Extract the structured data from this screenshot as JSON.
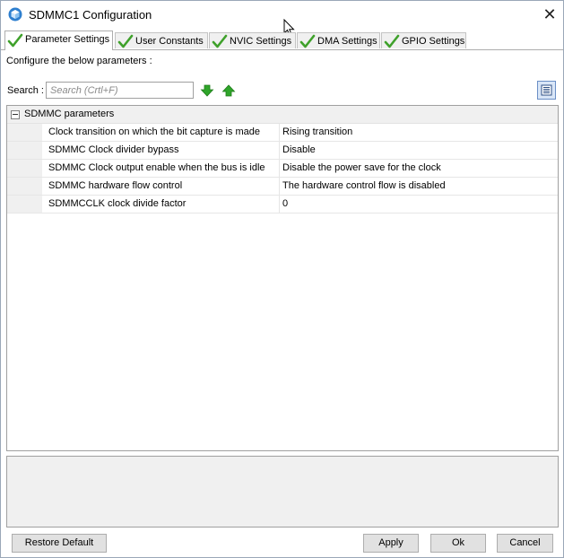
{
  "window": {
    "title": "SDMMC1 Configuration",
    "close_glyph": "✕"
  },
  "tabs": [
    {
      "label": "Parameter Settings",
      "active": true,
      "icon": "check-icon"
    },
    {
      "label": "User Constants",
      "active": false,
      "icon": "check-icon"
    },
    {
      "label": "NVIC Settings",
      "active": false,
      "icon": "check-icon"
    },
    {
      "label": "DMA Settings",
      "active": false,
      "icon": "check-icon"
    },
    {
      "label": "GPIO Settings",
      "active": false,
      "icon": "check-icon"
    }
  ],
  "configure_text": "Configure the below parameters :",
  "search": {
    "label": "Search :",
    "placeholder": "Search (Crtl+F)",
    "value": ""
  },
  "parameters": {
    "group_label": "SDMMC parameters",
    "rows": [
      {
        "name": "Clock transition on which the bit capture is made",
        "value": "Rising transition"
      },
      {
        "name": "SDMMC Clock divider bypass",
        "value": "Disable"
      },
      {
        "name": "SDMMC Clock output enable when the bus is idle",
        "value": "Disable the power save for the clock"
      },
      {
        "name": "SDMMC hardware flow control",
        "value": "The hardware control flow is disabled"
      },
      {
        "name": "SDMMCCLK clock divide factor",
        "value": "0"
      }
    ]
  },
  "buttons": {
    "restore_default": "Restore Default",
    "apply": "Apply",
    "ok": "Ok",
    "cancel": "Cancel"
  },
  "colors": {
    "check_green": "#3fa12b",
    "arrow_green": "#2fa52a",
    "grid_gutter": "#f0f0f0"
  }
}
